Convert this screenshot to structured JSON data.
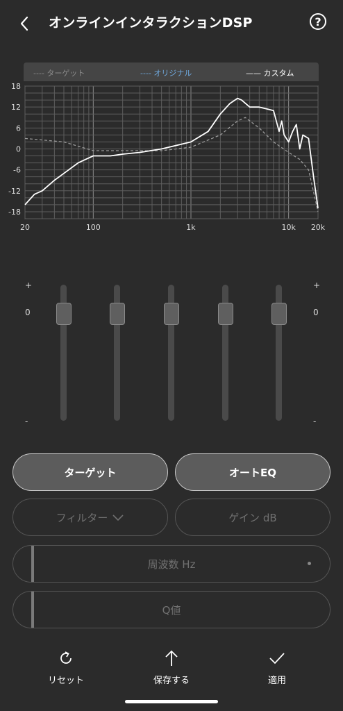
{
  "header": {
    "title": "オンラインインタラクションDSP",
    "help_label": "?"
  },
  "legend": {
    "target": "---- ターゲット",
    "original": "---- オリジナル",
    "custom": "—— カスタム"
  },
  "chart_data": {
    "type": "line",
    "ylim": [
      -20,
      18
    ],
    "yticks": [
      "18",
      "12",
      "6",
      "0",
      "-6",
      "-12",
      "-18"
    ],
    "xticks": [
      "20",
      "100",
      "1k",
      "10k",
      "20k"
    ],
    "grid": true,
    "series": [
      {
        "name": "ターゲット",
        "style": "dashed",
        "color": "#9a9a9a",
        "x": [
          20,
          50,
          100,
          200,
          500,
          1000,
          2000,
          3000,
          3600,
          5000,
          7000,
          10000,
          13000,
          16000,
          20000
        ],
        "y": [
          3,
          2,
          -0.5,
          -0.5,
          -0.5,
          0.5,
          4,
          8,
          9,
          6,
          2,
          -1,
          -3,
          -6,
          -18
        ]
      },
      {
        "name": "カスタム",
        "style": "solid",
        "color": "#ffffff",
        "x": [
          20,
          25,
          30,
          40,
          50,
          70,
          100,
          150,
          200,
          300,
          500,
          1000,
          1500,
          2000,
          2500,
          3000,
          3300,
          4000,
          5000,
          7000,
          8000,
          8500,
          9000,
          10000,
          11000,
          12000,
          13000,
          14000,
          16000,
          18000,
          20000
        ],
        "y": [
          -16,
          -13,
          -12,
          -9,
          -7,
          -4,
          -2,
          -2,
          -1.5,
          -1,
          0,
          2,
          5,
          10,
          13,
          14.5,
          14,
          12,
          12,
          11,
          5,
          8,
          4,
          2,
          5,
          7,
          0,
          4,
          3,
          -8,
          -17
        ]
      }
    ]
  },
  "sliders": {
    "plus": "+",
    "zero": "0",
    "minus": "-",
    "values": [
      0,
      0,
      0,
      0,
      0
    ]
  },
  "buttons": {
    "target": "ターゲット",
    "auto_eq": "オートEQ",
    "filter": "フィルター",
    "gain": "ゲイン  dB",
    "frequency": "周波数  Hz",
    "q": "Q値"
  },
  "bottom": {
    "reset": "リセット",
    "save": "保存する",
    "apply": "適用"
  }
}
